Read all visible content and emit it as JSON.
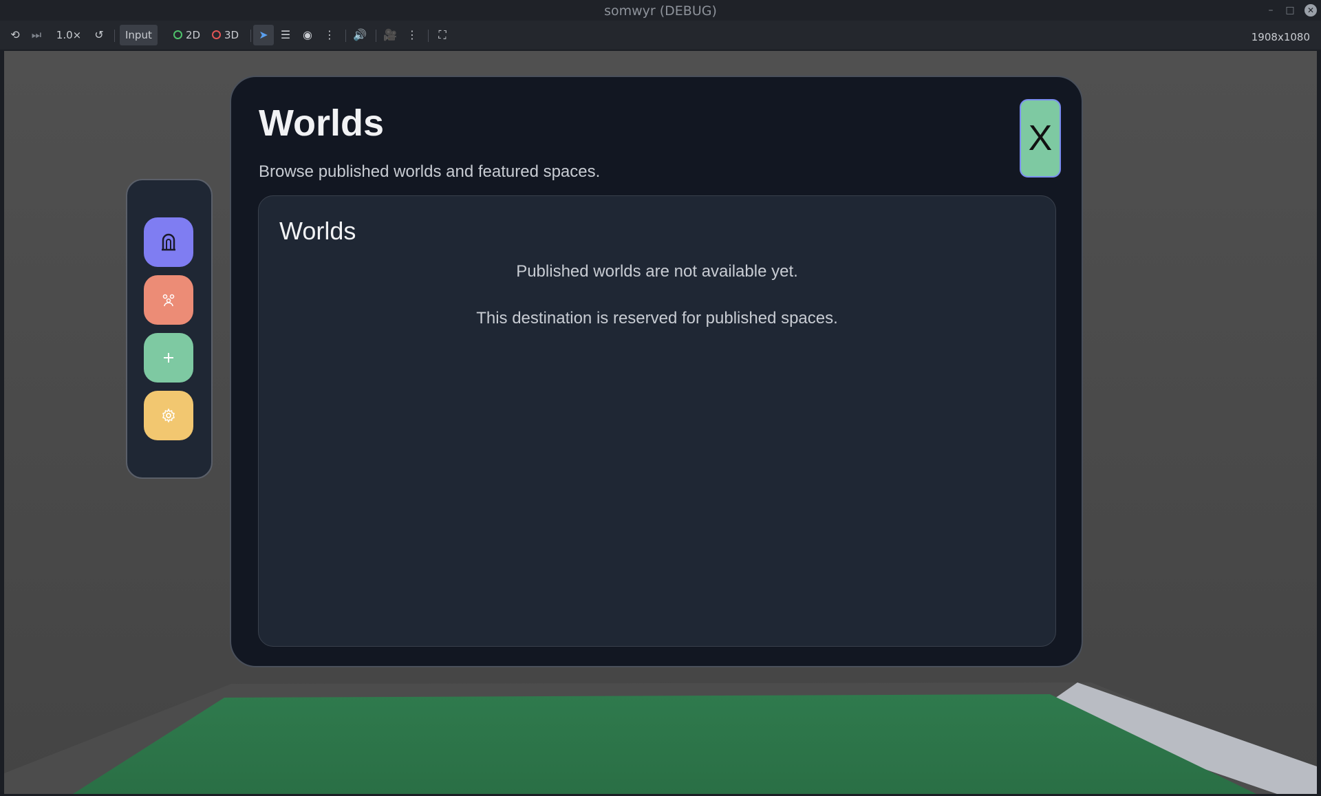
{
  "window": {
    "title": "somwyr (DEBUG)",
    "controls": {
      "minimize": "–",
      "maximize": "□",
      "close": "✕"
    }
  },
  "toolbar": {
    "speed": "1.0×",
    "input_label": "Input",
    "mode_2d": "2D",
    "mode_3d": "3D",
    "resolution": "1908x1080",
    "icons": {
      "pause": "⟲",
      "step": "⏭",
      "reset": "↺",
      "select": "➤",
      "list": "☰",
      "visibility": "◉",
      "more": "⋮",
      "audio": "🔊",
      "camera": "🎥",
      "fullscreen": "⛶"
    },
    "colors": {
      "mode_2d_dot": "#4fc26b",
      "mode_3d_dot": "#e25555",
      "accent": "#5aa0f0"
    }
  },
  "dock": {
    "items": [
      {
        "name": "worlds",
        "icon": "portal-icon",
        "color": "#7f7df2"
      },
      {
        "name": "people",
        "icon": "people-icon",
        "color": "#ec8c76"
      },
      {
        "name": "create",
        "icon": "plus-icon",
        "color": "#7ec9a2"
      },
      {
        "name": "settings",
        "icon": "gear-icon",
        "color": "#f2c770"
      }
    ]
  },
  "modal": {
    "title": "Worlds",
    "subtitle": "Browse published worlds and featured spaces.",
    "close_label": "X",
    "panel": {
      "title": "Worlds",
      "message_primary": "Published worlds are not available yet.",
      "message_secondary": "This destination is reserved for published spaces."
    }
  }
}
